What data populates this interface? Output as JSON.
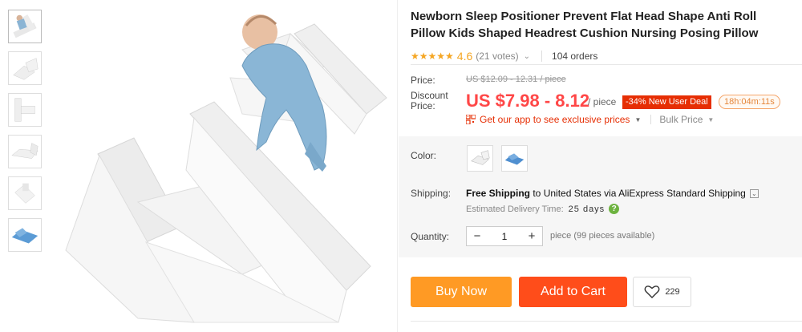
{
  "product": {
    "title": "Newborn Sleep Positioner Prevent Flat Head Shape Anti Roll Pillow Kids Shaped Headrest Cushion Nursing Posing Pillow",
    "stars": "★★★★★",
    "rating": "4.6",
    "votes": "(21 votes)",
    "orders": "104 orders"
  },
  "price": {
    "label": "Price:",
    "original": "US $12.09 - 12.31 / piece",
    "discount_label_1": "Discount",
    "discount_label_2": "Price:",
    "current": "US $7.98 - 8.12",
    "unit": "/ piece",
    "deal": "-34% New User Deal",
    "timer": "18h:04m:11s",
    "app_promo": "Get our app to see exclusive prices",
    "bulk": "Bulk Price"
  },
  "color": {
    "label": "Color:",
    "options": [
      "white-pillow",
      "blue-pillow"
    ]
  },
  "shipping": {
    "label": "Shipping:",
    "free": "Free Shipping",
    "to": " to ",
    "destination": "United States via AliExpress Standard Shipping",
    "estimate_label": "Estimated Delivery Time:",
    "estimate_days": "25 days"
  },
  "quantity": {
    "label": "Quantity:",
    "value": "1",
    "minus": "−",
    "plus": "+",
    "note": "piece (99 pieces available)"
  },
  "actions": {
    "buy_now": "Buy Now",
    "add_to_cart": "Add to Cart",
    "wishlist_count": "229"
  },
  "colors": {
    "price_red": "#ff4747",
    "buy_orange": "#ff9a24",
    "cart_red": "#ff4d1a",
    "star": "#f5a623"
  }
}
